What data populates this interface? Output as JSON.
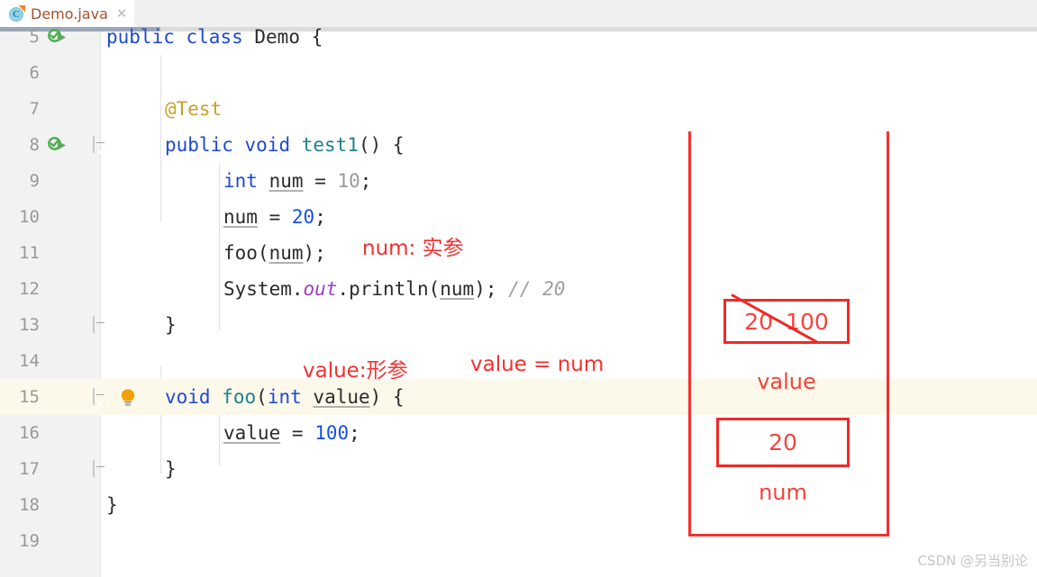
{
  "tab": {
    "filename": "Demo.java",
    "icon_name": "java-class-icon",
    "icon_letter": "C",
    "close_label": "✕"
  },
  "editor": {
    "lines": [
      {
        "no": "5",
        "has_run_icon": true,
        "has_fold": false,
        "has_bulb": false,
        "highlight": false
      },
      {
        "no": "6",
        "has_run_icon": false,
        "has_fold": false,
        "has_bulb": false,
        "highlight": false
      },
      {
        "no": "7",
        "has_run_icon": false,
        "has_fold": false,
        "has_bulb": false,
        "highlight": false
      },
      {
        "no": "8",
        "has_run_icon": true,
        "has_fold": true,
        "has_bulb": false,
        "highlight": false
      },
      {
        "no": "9",
        "has_run_icon": false,
        "has_fold": false,
        "has_bulb": false,
        "highlight": false
      },
      {
        "no": "10",
        "has_run_icon": false,
        "has_fold": false,
        "has_bulb": false,
        "highlight": false
      },
      {
        "no": "11",
        "has_run_icon": false,
        "has_fold": false,
        "has_bulb": false,
        "highlight": false
      },
      {
        "no": "12",
        "has_run_icon": false,
        "has_fold": false,
        "has_bulb": false,
        "highlight": false
      },
      {
        "no": "13",
        "has_run_icon": false,
        "has_fold": true,
        "has_bulb": false,
        "highlight": false
      },
      {
        "no": "14",
        "has_run_icon": false,
        "has_fold": false,
        "has_bulb": false,
        "highlight": false
      },
      {
        "no": "15",
        "has_run_icon": false,
        "has_fold": true,
        "has_bulb": true,
        "highlight": true
      },
      {
        "no": "16",
        "has_run_icon": false,
        "has_fold": false,
        "has_bulb": false,
        "highlight": false
      },
      {
        "no": "17",
        "has_run_icon": false,
        "has_fold": true,
        "has_bulb": false,
        "highlight": false
      },
      {
        "no": "18",
        "has_run_icon": false,
        "has_fold": false,
        "has_bulb": false,
        "highlight": false
      },
      {
        "no": "19",
        "has_run_icon": false,
        "has_fold": false,
        "has_bulb": false,
        "highlight": false
      }
    ],
    "code_text": {
      "l5": "public class Demo {",
      "l7": "@Test",
      "l8": "public void test1() {",
      "l9": "int num = 10;",
      "l10": "num = 20;",
      "l11": "foo(num);",
      "l12": "System.out.println(num); // 20",
      "l13": "}",
      "l15": "void foo(int value) {",
      "l16": "value = 100;",
      "l17": "}",
      "l18": "}"
    }
  },
  "annotations": {
    "note_actual_param": "num: 实参",
    "note_formal_param": "value:形参",
    "note_assignment": "value = num",
    "value_box_old": "20",
    "value_box_new": "100",
    "value_box_label": "value",
    "num_box_value": "20",
    "num_box_label": "num",
    "accent_color": "#f3312f"
  },
  "watermark": "CSDN @另当别论"
}
